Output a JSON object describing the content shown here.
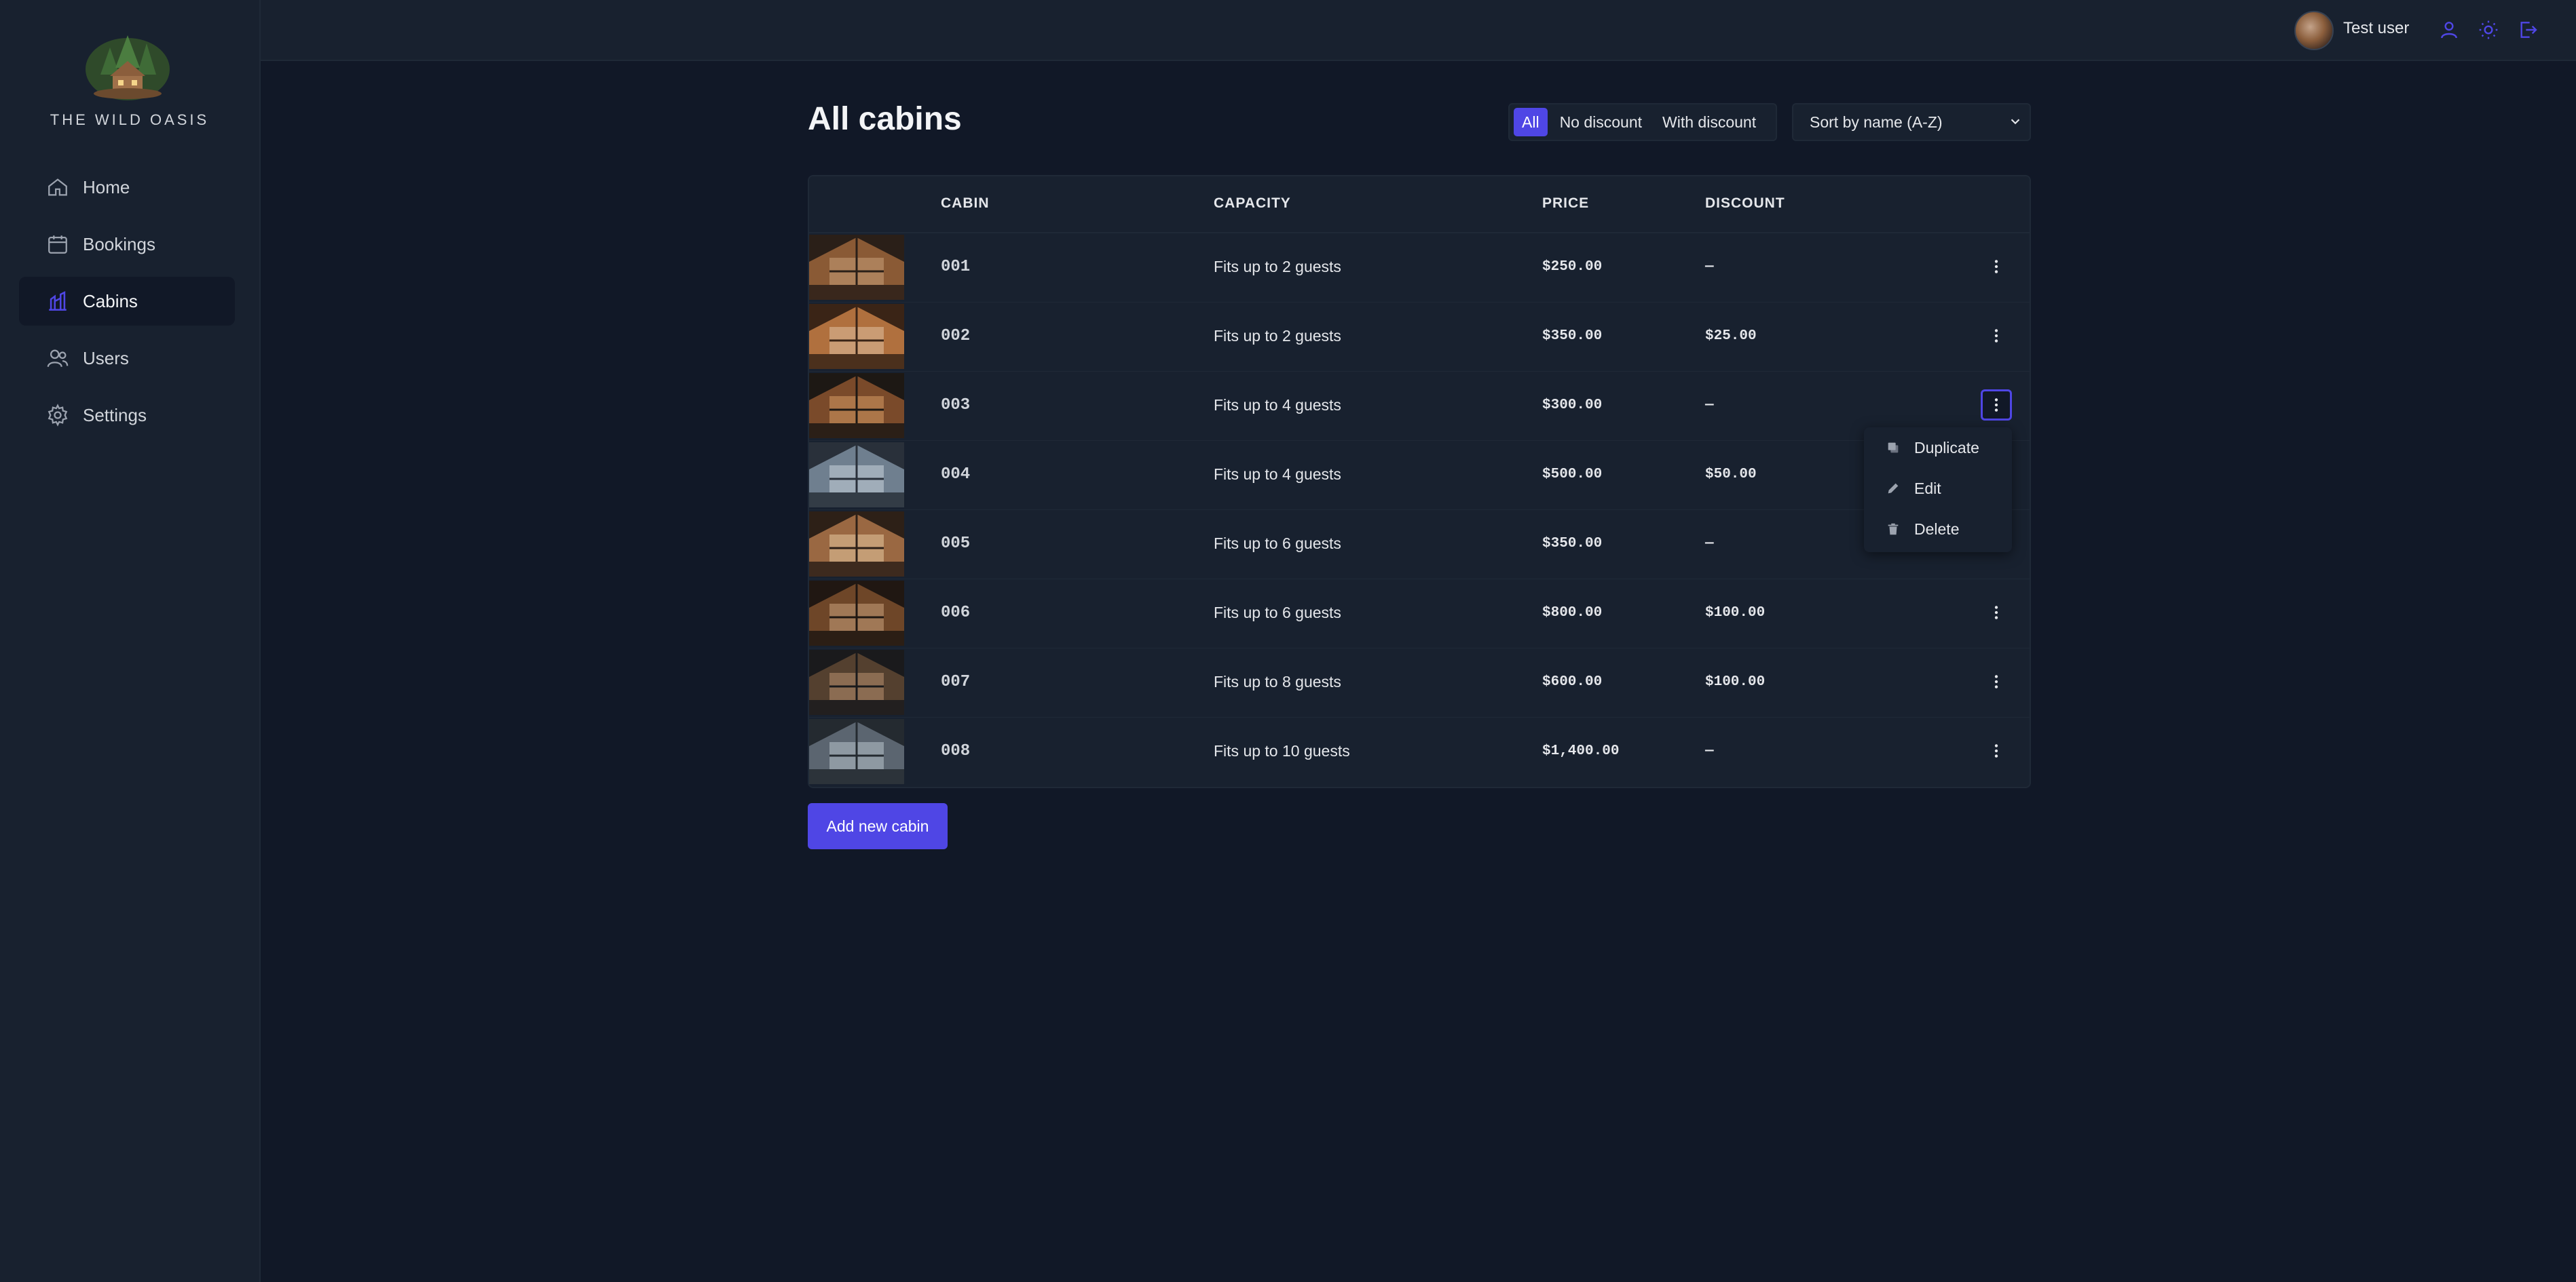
{
  "brand": {
    "name": "THE WILD OASIS"
  },
  "nav": [
    {
      "label": "Home",
      "icon": "home-icon",
      "active": false
    },
    {
      "label": "Bookings",
      "icon": "calendar-icon",
      "active": false
    },
    {
      "label": "Cabins",
      "icon": "cabins-icon",
      "active": true
    },
    {
      "label": "Users",
      "icon": "users-icon",
      "active": false
    },
    {
      "label": "Settings",
      "icon": "gear-icon",
      "active": false
    }
  ],
  "header": {
    "username": "Test user",
    "icons": [
      "user-icon",
      "sun-icon",
      "logout-icon"
    ]
  },
  "page": {
    "title": "All cabins"
  },
  "filter": {
    "options": [
      "All",
      "No discount",
      "With discount"
    ],
    "active": "All"
  },
  "sort": {
    "selected": "Sort by name (A-Z)"
  },
  "table": {
    "headers": [
      "CABIN",
      "CAPACITY",
      "PRICE",
      "DISCOUNT"
    ],
    "rows": [
      {
        "name": "001",
        "capacity": "Fits up to 2 guests",
        "price": "$250.00",
        "discount": "—"
      },
      {
        "name": "002",
        "capacity": "Fits up to 2 guests",
        "price": "$350.00",
        "discount": "$25.00"
      },
      {
        "name": "003",
        "capacity": "Fits up to 4 guests",
        "price": "$300.00",
        "discount": "—"
      },
      {
        "name": "004",
        "capacity": "Fits up to 4 guests",
        "price": "$500.00",
        "discount": "$50.00"
      },
      {
        "name": "005",
        "capacity": "Fits up to 6 guests",
        "price": "$350.00",
        "discount": "—"
      },
      {
        "name": "006",
        "capacity": "Fits up to 6 guests",
        "price": "$800.00",
        "discount": "$100.00"
      },
      {
        "name": "007",
        "capacity": "Fits up to 8 guests",
        "price": "$600.00",
        "discount": "$100.00"
      },
      {
        "name": "008",
        "capacity": "Fits up to 10 guests",
        "price": "$1,400.00",
        "discount": "—"
      }
    ]
  },
  "context_menu": {
    "items": [
      "Duplicate",
      "Edit",
      "Delete"
    ]
  },
  "actions": {
    "add_label": "Add new cabin"
  },
  "colors": {
    "accent": "#4f46e5",
    "background": "#111827",
    "panel": "#18212f"
  }
}
